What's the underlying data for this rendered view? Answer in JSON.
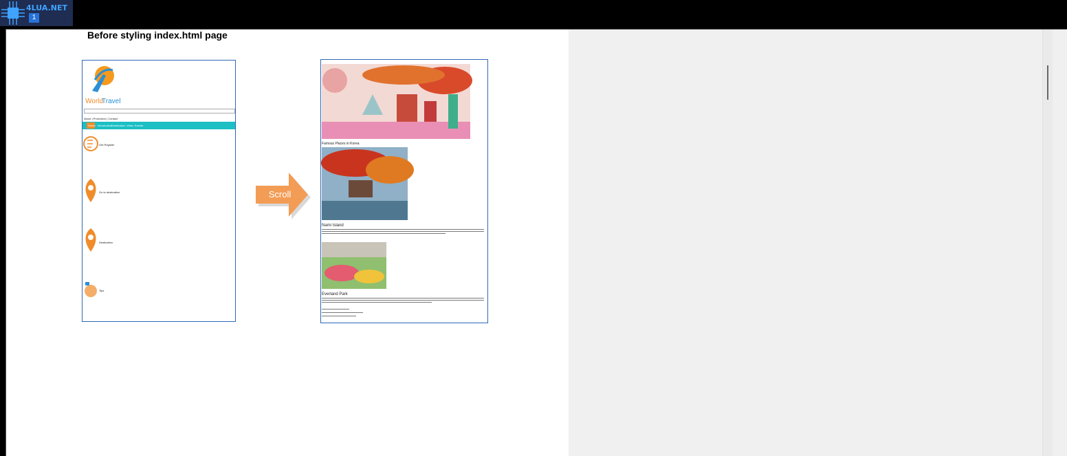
{
  "brand": {
    "name": "4LUA.NET",
    "sub": "1"
  },
  "heading": "Before styling index.html page",
  "screen1": {
    "site_name_world": "World",
    "site_name_travel": "Travel",
    "links": "About | Promotion | Contact",
    "nav": [
      "Home",
      "Introduction",
      "Destination",
      "Video",
      "Events"
    ],
    "sections": [
      "Get Register",
      "Go to destination",
      "Destination",
      "Tips"
    ]
  },
  "arrow_label": "Scroll",
  "screen2": {
    "headline": "Famous Places in Korea",
    "place1": "Nami Island",
    "place2": "Everland Park"
  },
  "colors": {
    "teal": "#1bbfc4",
    "orange": "#f08c2a",
    "blue": "#2d67b5"
  }
}
